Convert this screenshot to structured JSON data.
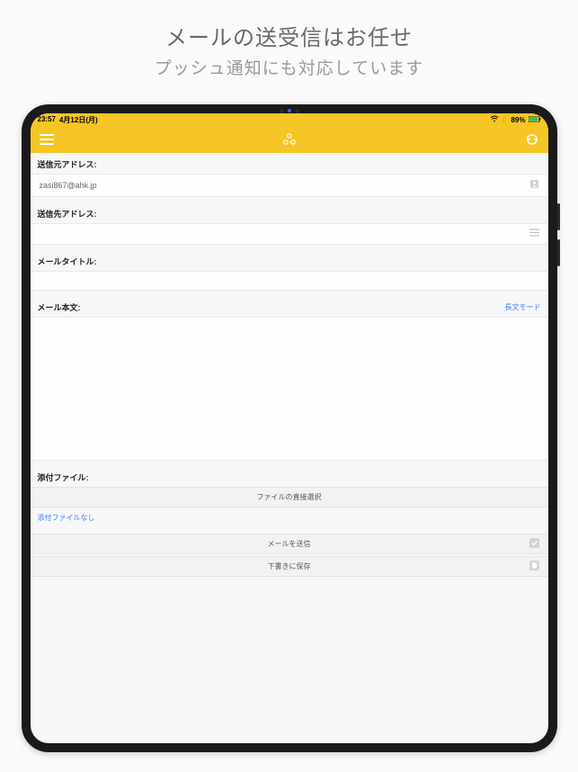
{
  "promo": {
    "title": "メールの送受信はお任せ",
    "subtitle": "プッシュ通知にも対応しています"
  },
  "status": {
    "time": "23:57",
    "date": "4月12日(月)",
    "battery": "89%"
  },
  "labels": {
    "from": "送信元アドレス:",
    "to": "送信先アドレス:",
    "subject": "メールタイトル:",
    "body": "メール本文:",
    "longMode": "長文モード",
    "attachment": "添付ファイル:",
    "selectFile": "ファイルの直接選択",
    "noAttachment": "添付ファイルなし",
    "send": "メールを送信",
    "saveDraft": "下書きに保存"
  },
  "values": {
    "from": "zasi867@ahk.jp",
    "to": "",
    "subject": "",
    "body": ""
  }
}
